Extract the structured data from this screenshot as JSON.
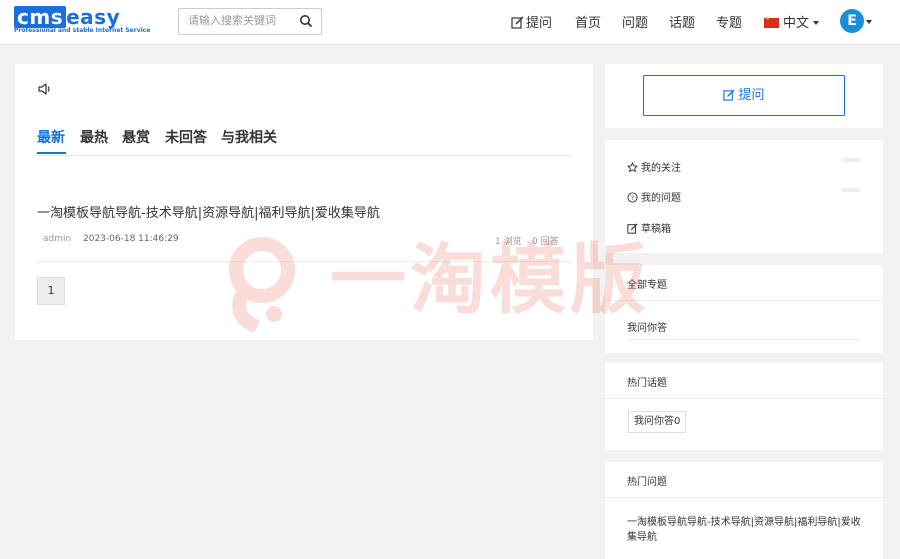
{
  "logo": {
    "main": "cmseasy",
    "tagline": "Professional and stable Internet Service"
  },
  "search": {
    "placeholder": "请输入搜索关键词"
  },
  "nav": {
    "ask": "提问",
    "home": "首页",
    "questions": "问题",
    "topics": "话题",
    "special": "专题",
    "language": "中文",
    "avatar_letter": "E"
  },
  "tabs": [
    "最新",
    "最热",
    "悬赏",
    "未回答",
    "与我相关"
  ],
  "question": {
    "title": "一淘模板导航导航-技术导航|资源导航|福利导航|爱收集导航",
    "author": "admin",
    "time": "2023-06-18 11:46:29",
    "views": "1 浏览",
    "answers": "0 回答"
  },
  "pagination": {
    "current": "1"
  },
  "sidebar": {
    "ask_button": "提问",
    "links": [
      "我的关注",
      "我的问题",
      "草稿箱"
    ],
    "all_special": {
      "title": "全部专题",
      "items": [
        "我问你答"
      ]
    },
    "hot_topics": {
      "title": "热门话题",
      "tag": "我问你答0"
    },
    "hot_questions": {
      "title": "热门问题",
      "items": [
        "一淘模板导航导航-技术导航|资源导航|福利导航|爱收集导航"
      ]
    }
  },
  "watermark": {
    "text": "一淘模版"
  },
  "colors": {
    "accent": "#1a6fd8",
    "watermark": "#e8452c"
  }
}
